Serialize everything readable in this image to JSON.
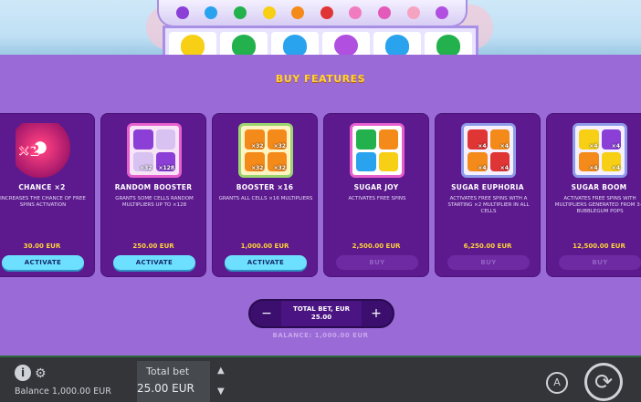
{
  "modal": {
    "title": "BUY FEATURES",
    "features": [
      {
        "name": "CHANCE ×2",
        "description": "INCREASES THE CHANCE OF FREE SPINS ACTIVATION",
        "price": "30.00 EUR",
        "button": "ACTIVATE",
        "enabled": true,
        "badge": "×2"
      },
      {
        "name": "RANDOM BOOSTER",
        "description": "GRANTS SOME CELLS RANDOM MULTIPLIERS UP TO ×128",
        "price": "250.00 EUR",
        "button": "ACTIVATE",
        "enabled": true,
        "mults": [
          "×32",
          "×128"
        ]
      },
      {
        "name": "BOOSTER ×16",
        "description": "GRANTS ALL CELLS ×16 MULTIPLIERS",
        "price": "1,000.00 EUR",
        "button": "ACTIVATE",
        "enabled": true,
        "mults": [
          "×32",
          "×32",
          "×32",
          "×32"
        ]
      },
      {
        "name": "SUGAR JOY",
        "description": "ACTIVATES FREE SPINS",
        "price": "2,500.00 EUR",
        "button": "BUY",
        "enabled": false
      },
      {
        "name": "SUGAR EUPHORIA",
        "description": "ACTIVATES FREE SPINS WITH A STARTING ×2 MULTIPLIER IN ALL CELLS",
        "price": "6,250.00 EUR",
        "button": "BUY",
        "enabled": false,
        "mults": [
          "×4",
          "×4",
          "×4",
          "×4"
        ]
      },
      {
        "name": "SUGAR BOOM",
        "description": "ACTIVATES FREE SPINS WITH MULTIPLIERS GENERATED FROM 3-9 BUBBLEGUM POPS",
        "price": "12,500.00 EUR",
        "button": "BUY",
        "enabled": false,
        "mults": [
          "×4",
          "×4",
          "×4",
          "×4"
        ]
      }
    ],
    "bet": {
      "minus": "−",
      "plus": "+",
      "label": "TOTAL BET, EUR",
      "value": "25.00"
    },
    "balance_line": "BALANCE: 1,000.00 EUR"
  },
  "bottom_bar": {
    "info": "i",
    "balance": "Balance 1,000.00 EUR",
    "total_bet_label": "Total bet",
    "total_bet_value": "25.00 EUR",
    "autoplay": "A"
  },
  "colors": {
    "accent": "#ffd23a",
    "activate": "#6ee0ff",
    "card": "#5c1a8e",
    "overlay": "#9a6ad6"
  }
}
